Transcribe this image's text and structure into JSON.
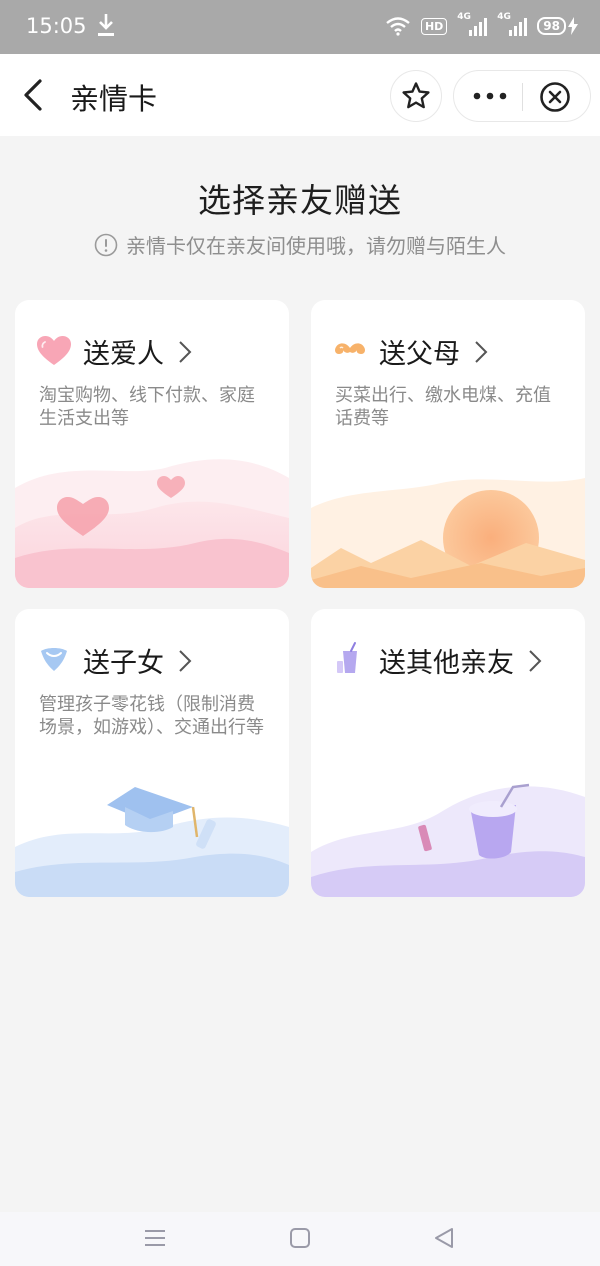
{
  "status": {
    "time": "15:05",
    "hd": "HD",
    "net1": "4G",
    "net2": "4G",
    "battery": "98"
  },
  "nav": {
    "title": "亲情卡"
  },
  "main": {
    "heading": "选择亲友赠送",
    "tip": "亲情卡仅在亲友间使用哦，请勿赠与陌生人"
  },
  "cards": [
    {
      "title": "送爱人",
      "desc": "淘宝购物、线下付款、家庭生活支出等",
      "accent": "#f7a4b4"
    },
    {
      "title": "送父母",
      "desc": "买菜出行、缴水电煤、充值话费等",
      "accent": "#f9b46f"
    },
    {
      "title": "送子女",
      "desc": "管理孩子零花钱（限制消费场景，如游戏）、交通出行等",
      "accent": "#9ec3f2"
    },
    {
      "title": "送其他亲友",
      "desc": "",
      "accent": "#b3a4ef"
    }
  ],
  "icons": {
    "back": "back-arrow-icon",
    "star": "star-icon",
    "more": "more-dots-icon",
    "close": "close-circle-icon",
    "info": "info-icon"
  }
}
